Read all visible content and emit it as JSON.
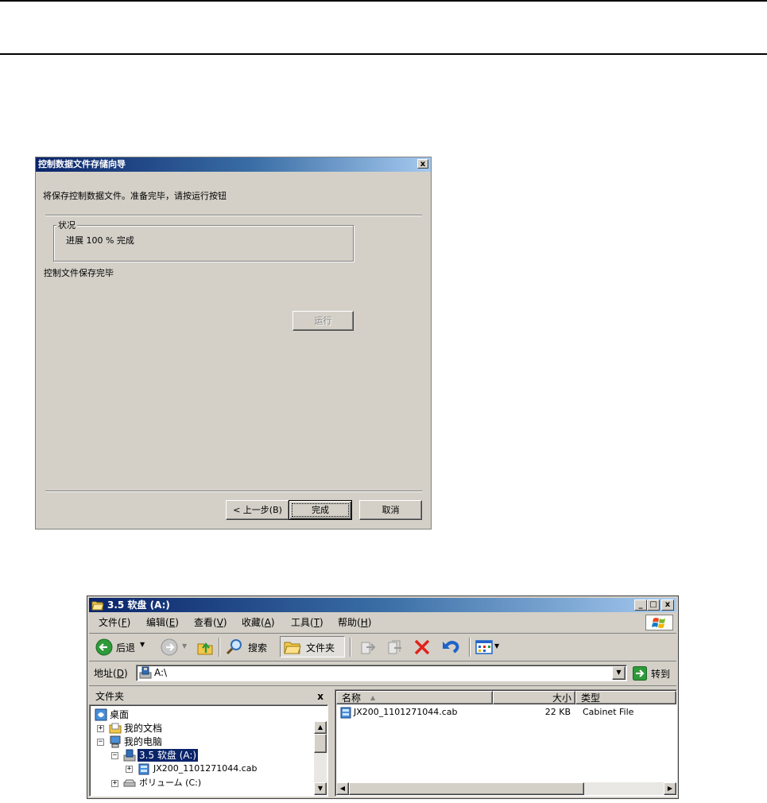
{
  "wizard": {
    "title": "控制数据文件存储向导",
    "close": "x",
    "instruction": "将保存控制数据文件。准备完毕，请按运行按钮",
    "status_group": "状况",
    "progress_text": "进展  100 % 完成",
    "complete_message": "控制文件保存完毕",
    "run_button": "运行",
    "back_button": "< 上一步(B)",
    "finish_button": "完成",
    "cancel_button": "取消"
  },
  "explorer": {
    "title": "3.5 软盘 (A:)",
    "window_buttons": {
      "minimize": "_",
      "maximize": "□",
      "close": "x"
    },
    "menu": [
      {
        "label": "文件(",
        "key": "F",
        "end": ")"
      },
      {
        "label": "编辑(",
        "key": "E",
        "end": ")"
      },
      {
        "label": "查看(",
        "key": "V",
        "end": ")"
      },
      {
        "label": "收藏(",
        "key": "A",
        "end": ")"
      },
      {
        "label": "工具(",
        "key": "T",
        "end": ")"
      },
      {
        "label": "帮助(",
        "key": "H",
        "end": ")"
      }
    ],
    "toolbar": {
      "back_label": "后退",
      "search_label": "搜索",
      "folders_label": "文件夹"
    },
    "address": {
      "label": "地址(",
      "key": "D",
      "end": ")",
      "value": "A:\\",
      "go_label": "转到"
    },
    "folders_pane": {
      "header": "文件夹",
      "close": "x",
      "tree": [
        {
          "label": "桌面"
        },
        {
          "label": "我的文档",
          "expander": "+"
        },
        {
          "label": "我的电脑",
          "expander": "−"
        },
        {
          "label": "3.5 软盘 (A:)",
          "expander": "−"
        },
        {
          "label": "JX200_1101271044.cab",
          "expander": "+"
        },
        {
          "label": "ボリューム (C:)",
          "expander": "+"
        }
      ]
    },
    "file_list": {
      "columns": {
        "name": "名称",
        "sort_indicator": "▲",
        "size": "大小",
        "type": "类型"
      },
      "rows": [
        {
          "name": "JX200_1101271044.cab",
          "size": "22 KB",
          "type": "Cabinet File"
        }
      ]
    }
  }
}
